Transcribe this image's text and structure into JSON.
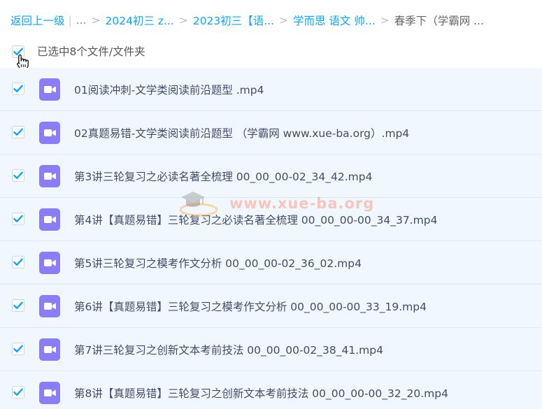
{
  "breadcrumb": {
    "back_label": "返回上一级",
    "ellipsis": "...",
    "items": [
      "2024初三 z...",
      "2023初三【语...",
      "学而思 语文 帅...",
      "春季下（学霸网 ..."
    ]
  },
  "selection": {
    "label": "已选中8个文件/文件夹"
  },
  "files": [
    {
      "name": "01阅读冲刺-文学类阅读前沿题型 .mp4"
    },
    {
      "name": "02真题易错-文学类阅读前沿题型 （学霸网 www.xue-ba.org）.mp4"
    },
    {
      "name": "第3讲三轮复习之必读名著全梳理 00_00_00-02_34_42.mp4"
    },
    {
      "name": "第4讲【真题易错】三轮复习之必读名著全梳理 00_00_00-00_34_37.mp4"
    },
    {
      "name": "第5讲三轮复习之模考作文分析 00_00_00-02_36_02.mp4"
    },
    {
      "name": "第6讲【真题易错】三轮复习之模考作文分析 00_00_00-00_33_19.mp4"
    },
    {
      "name": "第7讲三轮复习之创新文本考前技法 00_00_00-02_38_41.mp4"
    },
    {
      "name": "第8讲【真题易错】三轮复习之创新文本考前技法 00_00_00-00_32_20.mp4"
    }
  ],
  "watermark": {
    "text": "www.xue-ba.org"
  },
  "colors": {
    "link": "#06a7ff",
    "checkbox_check": "#06a7ff",
    "row_bg": "#f1f7fe",
    "video_icon": "#8a7df7"
  },
  "icons": {
    "checkbox": "checkmark-icon",
    "file": "video-file-icon",
    "cursor": "hand-cursor-icon",
    "watermark_logo": "graduation-cap-icon"
  }
}
